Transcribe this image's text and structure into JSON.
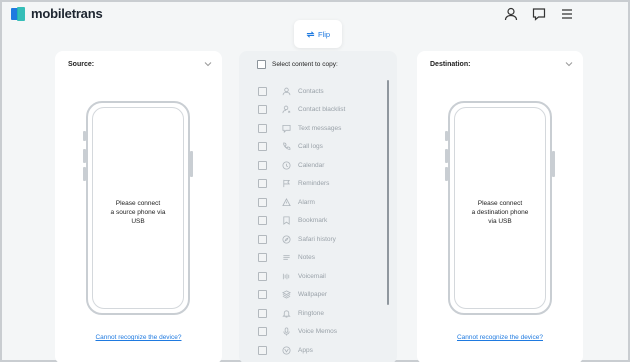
{
  "app": {
    "name": "mobiletrans"
  },
  "header": {
    "flip_label": "Flip",
    "icons": [
      "user-icon",
      "feedback-icon",
      "menu-icon"
    ]
  },
  "source": {
    "title": "Source:",
    "phone_text": [
      "Please connect",
      "a source phone via",
      "USB"
    ],
    "recognize_link": "Cannot recognize the device?"
  },
  "destination": {
    "title": "Destination:",
    "phone_text": [
      "Please connect",
      "a destination phone",
      "via USB"
    ],
    "recognize_link": "Cannot recognize the device?"
  },
  "content": {
    "select_all_label": "Select content to copy:",
    "items": [
      {
        "label": "Contacts",
        "icon": "contact-icon"
      },
      {
        "label": "Contact blacklist",
        "icon": "blacklist-icon"
      },
      {
        "label": "Text messages",
        "icon": "message-icon"
      },
      {
        "label": "Call logs",
        "icon": "phone-icon"
      },
      {
        "label": "Calendar",
        "icon": "calendar-icon"
      },
      {
        "label": "Reminders",
        "icon": "flag-icon"
      },
      {
        "label": "Alarm",
        "icon": "alarm-icon"
      },
      {
        "label": "Bookmark",
        "icon": "bookmark-icon"
      },
      {
        "label": "Safari history",
        "icon": "compass-icon"
      },
      {
        "label": "Notes",
        "icon": "notes-icon"
      },
      {
        "label": "Voicemail",
        "icon": "voicemail-icon"
      },
      {
        "label": "Wallpaper",
        "icon": "wallpaper-icon"
      },
      {
        "label": "Ringtone",
        "icon": "bell-icon"
      },
      {
        "label": "Voice Memos",
        "icon": "mic-icon"
      },
      {
        "label": "Apps",
        "icon": "apps-icon"
      }
    ]
  },
  "colors": {
    "accent": "#1f7ae0",
    "brand_teal": "#20b8b0",
    "background": "#f4f6f7"
  }
}
